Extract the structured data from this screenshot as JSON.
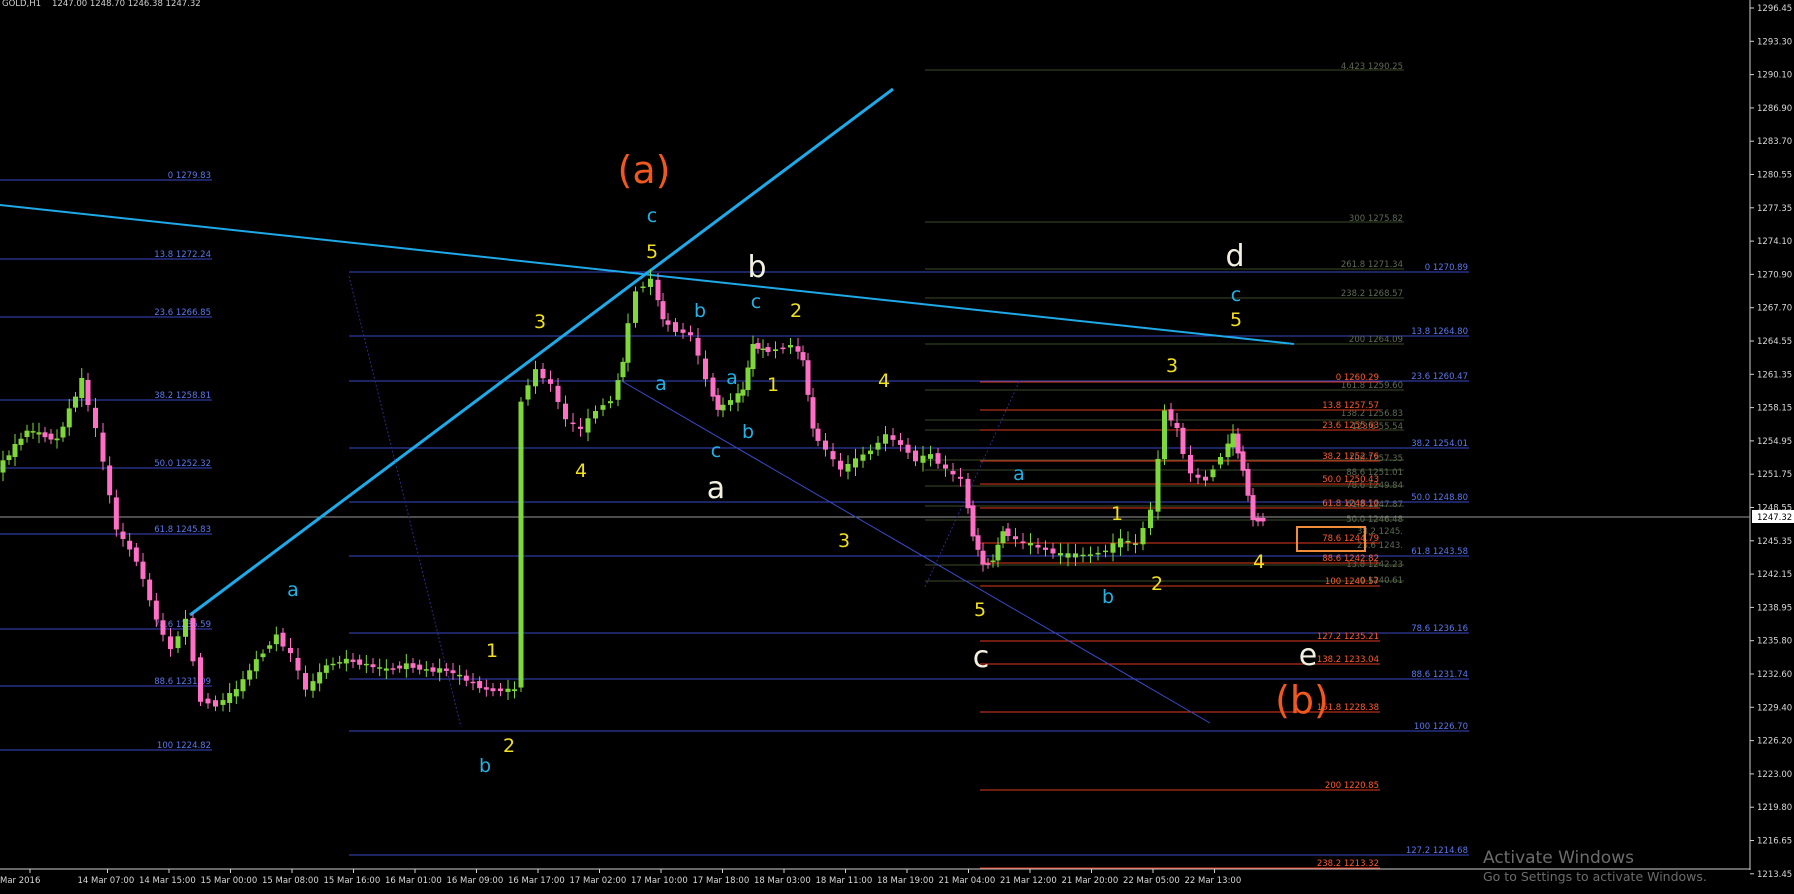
{
  "header": {
    "symbol_label": "GOLD,H1",
    "ohlc_label": "1247.00 1248.70 1246.38 1247.32"
  },
  "price_axis": {
    "labels": [
      "1296.45",
      "1293.30",
      "1290.10",
      "1286.90",
      "1283.70",
      "1280.55",
      "1277.35",
      "1274.10",
      "1270.90",
      "1267.70",
      "1264.55",
      "1261.35",
      "1258.15",
      "1254.95",
      "1251.75",
      "1248.55",
      "1245.35",
      "1242.15",
      "1238.95",
      "1235.80",
      "1232.60",
      "1229.40",
      "1226.20",
      "1223.00",
      "1219.80",
      "1216.65",
      "1213.45"
    ],
    "current_price": "1247.32"
  },
  "time_axis": {
    "labels": [
      "Mar 2016",
      "14 Mar 07:00",
      "14 Mar 15:00",
      "15 Mar 00:00",
      "15 Mar 08:00",
      "15 Mar 16:00",
      "16 Mar 01:00",
      "16 Mar 09:00",
      "16 Mar 17:00",
      "17 Mar 02:00",
      "17 Mar 10:00",
      "17 Mar 18:00",
      "18 Mar 03:00",
      "18 Mar 11:00",
      "18 Mar 19:00",
      "21 Mar 04:00",
      "21 Mar 12:00",
      "21 Mar 20:00",
      "22 Mar 05:00",
      "22 Mar 13:00"
    ]
  },
  "fib_left": [
    "0 1279.83",
    "13.8 1272.24",
    "23.6 1266.85",
    "38.2 1258.81",
    "50.0 1252.32",
    "61.8 1245.83",
    "78.6 1236.59",
    "88.6 1231.09",
    "100 1224.82"
  ],
  "fib_mid": [
    "127.2 1214.68"
  ],
  "fib_right": [
    "0 1270.89",
    "13.8 1264.80",
    "23.6 1260.47",
    "38.2 1254.01",
    "50.0 1248.80",
    "61.8 1243.58",
    "78.6 1236.16",
    "88.6 1231.74",
    "100 1226.70"
  ],
  "fib_red": [
    "0 1260.29",
    "13.8 1257.57",
    "23.6 1255.63",
    "38.2 1252.76",
    "50.0 1250.43",
    "61.8 1248.10",
    "78.6 1244.79",
    "88.6 1242.82",
    "100 1240.57",
    "127.2 1235.21",
    "138.2 1233.04",
    "161.8 1228.38",
    "200 1220.85",
    "238.2 1213.32"
  ],
  "fib_green": [
    "4.423 1290.25",
    "300 1275.82",
    "261.8 1271.34",
    "238.2 1268.57",
    "200 1264.09",
    "161.8 1259.60",
    "138.2 1256.83",
    "123.6 55.54",
    "100 1257.35",
    "88.6 1251.01",
    "78.6 1249.84",
    "61.8 1247.87",
    "50.0 1246.48",
    "38.2 1245.",
    "23.6 1243.",
    "13.8 1242.23",
    "0 1240.61"
  ],
  "wave_labels": {
    "a_major": "(a)",
    "b_major": "(b)",
    "b_white": "b",
    "a_white": "a",
    "c_white": "c",
    "d_white": "d",
    "e_white": "e",
    "c_cyan_top": "c",
    "b_cyan": "b",
    "c_cyan": "c",
    "a_cyan": "a",
    "a_cyan2": "a",
    "c_cyan2": "c",
    "b_cyan2": "b",
    "a_cyan3": "a",
    "b_cyan3": "b",
    "b_cyan4": "b",
    "c_cyan_d": "c",
    "five_top": "5",
    "three_left": "3",
    "four_left": "4",
    "one_left": "1",
    "two_left": "2",
    "two_mid": "2",
    "one_mid": "1",
    "four_mid": "4",
    "three_mid": "3",
    "five_bottom": "5",
    "one_right": "1",
    "three_right": "3",
    "two_right": "2",
    "four_right": "4",
    "five_d": "5"
  },
  "watermark": {
    "title": "Activate Windows",
    "subtitle": "Go to Settings to activate Windows."
  },
  "colors": {
    "bull": "#7fd83a",
    "bear": "#ff6fc6",
    "trendline": "#1ea9e8",
    "fib_blue": "#3a49c8",
    "fib_red": "#e0391c",
    "fib_green": "#4a5a3a",
    "wave_orange": "#f0581e",
    "wave_yellow": "#f1e01e",
    "wave_cyan": "#21b2e6",
    "wave_white": "#f3f0e0"
  }
}
